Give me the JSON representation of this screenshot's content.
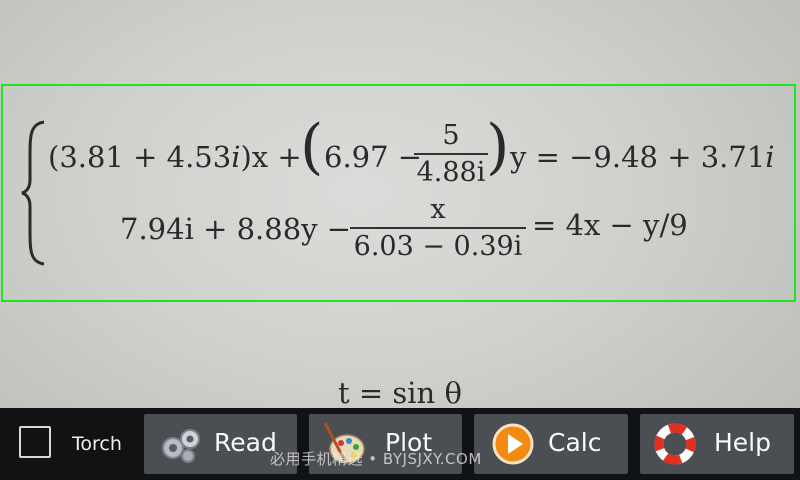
{
  "equation": {
    "line1_left": "(3.81 + 4.53",
    "i1": "i",
    "line1_x": ")x +",
    "line1_mid": "6.97 −",
    "frac1_num": "5",
    "frac1_den": "4.88i",
    "line1_right": "y = −9.48 + 3.71",
    "i2": "i",
    "line2_left": "7.94i + 8.88y −",
    "frac2_num": "x",
    "frac2_den": "6.03 − 0.39i",
    "line2_right": "= 4x − y/9",
    "below": "t = sin θ"
  },
  "toolbar": {
    "torch_label": "Torch",
    "read_label": "Read",
    "plot_label": "Plot",
    "calc_label": "Calc",
    "help_label": "Help"
  },
  "watermark": "必用手机精选 • BYJSJXY.COM",
  "colors": {
    "scan_frame": "#1ee61e",
    "toolbar": "#111214",
    "button": "#4b4e52"
  }
}
